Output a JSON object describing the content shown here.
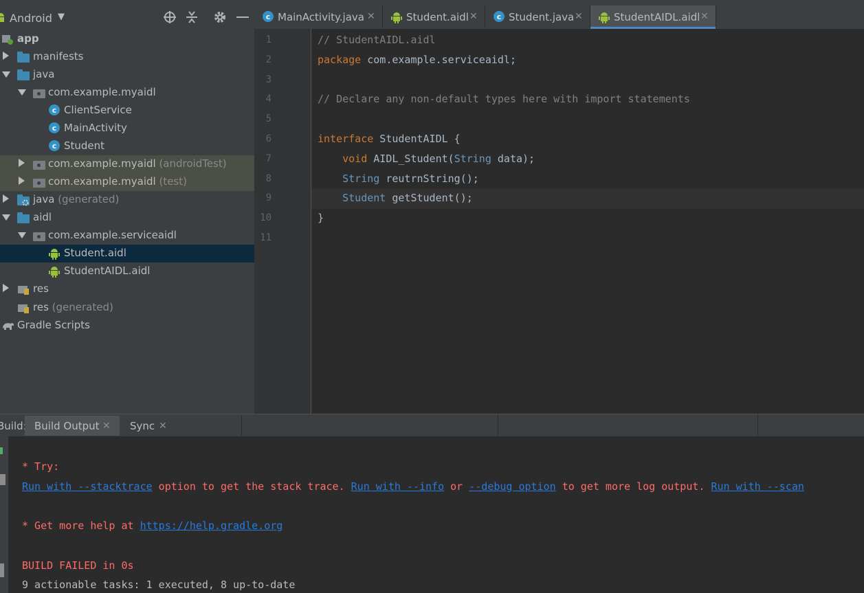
{
  "project_panel": {
    "view_mode": "Android",
    "tree": [
      {
        "label": "app",
        "sublabel": "",
        "icon": "app-module-icon"
      },
      {
        "label": "manifests",
        "sublabel": "",
        "icon": "folder-icon"
      },
      {
        "label": "java",
        "sublabel": "",
        "icon": "folder-icon"
      },
      {
        "label": "com.example.myaidl",
        "sublabel": "",
        "icon": "package-icon"
      },
      {
        "label": "ClientService",
        "sublabel": "",
        "icon": "class-icon"
      },
      {
        "label": "MainActivity",
        "sublabel": "",
        "icon": "class-icon"
      },
      {
        "label": "Student",
        "sublabel": "",
        "icon": "class-icon"
      },
      {
        "label": "com.example.myaidl",
        "sublabel": " (androidTest)",
        "icon": "package-icon"
      },
      {
        "label": "com.example.myaidl",
        "sublabel": " (test)",
        "icon": "package-icon"
      },
      {
        "label": "java",
        "sublabel": " (generated)",
        "icon": "generated-folder-icon"
      },
      {
        "label": "aidl",
        "sublabel": "",
        "icon": "folder-icon"
      },
      {
        "label": "com.example.serviceaidl",
        "sublabel": "",
        "icon": "package-icon"
      },
      {
        "label": "Student.aidl",
        "sublabel": "",
        "icon": "android-icon"
      },
      {
        "label": "StudentAIDL.aidl",
        "sublabel": "",
        "icon": "android-icon"
      },
      {
        "label": "res",
        "sublabel": "",
        "icon": "res-folder-icon"
      },
      {
        "label": "res",
        "sublabel": " (generated)",
        "icon": "res-folder-icon"
      },
      {
        "label": "Gradle Scripts",
        "sublabel": "",
        "icon": "gradle-icon"
      }
    ]
  },
  "editor": {
    "tabs": [
      {
        "label": "MainActivity.java",
        "icon": "class-icon"
      },
      {
        "label": "Student.aidl",
        "icon": "android-icon"
      },
      {
        "label": "Student.java",
        "icon": "class-icon"
      },
      {
        "label": "StudentAIDL.aidl",
        "icon": "android-icon"
      }
    ],
    "active_tab": "StudentAIDL.aidl",
    "current_line": 9,
    "lines": [
      {
        "n": "1",
        "parts": [
          {
            "t": "// StudentAIDL.aidl",
            "c": "cm"
          }
        ]
      },
      {
        "n": "2",
        "parts": [
          {
            "t": "package",
            "c": "kw"
          },
          {
            "t": " com.example.serviceaidl;",
            "c": "ident"
          }
        ]
      },
      {
        "n": "3",
        "parts": []
      },
      {
        "n": "4",
        "parts": [
          {
            "t": "// Declare any non-default types here with import statements",
            "c": "cm"
          }
        ]
      },
      {
        "n": "5",
        "parts": []
      },
      {
        "n": "6",
        "parts": [
          {
            "t": "interface",
            "c": "kw"
          },
          {
            "t": " StudentAIDL {",
            "c": "ident"
          }
        ]
      },
      {
        "n": "7",
        "parts": [
          {
            "t": "    ",
            "c": "ident"
          },
          {
            "t": "void",
            "c": "kw"
          },
          {
            "t": " AIDL_Student(",
            "c": "ident"
          },
          {
            "t": "String",
            "c": "ty"
          },
          {
            "t": " data);",
            "c": "ident"
          }
        ]
      },
      {
        "n": "8",
        "parts": [
          {
            "t": "    ",
            "c": "ident"
          },
          {
            "t": "String",
            "c": "ty"
          },
          {
            "t": " reutrnString();",
            "c": "ident"
          }
        ]
      },
      {
        "n": "9",
        "parts": [
          {
            "t": "    ",
            "c": "ident"
          },
          {
            "t": "Student",
            "c": "ty"
          },
          {
            "t": " getStudent();",
            "c": "ident"
          }
        ]
      },
      {
        "n": "10",
        "parts": [
          {
            "t": "}",
            "c": "ident"
          }
        ]
      },
      {
        "n": "11",
        "parts": []
      }
    ]
  },
  "build_panel": {
    "label": "Build:",
    "tabs": [
      "Build Output",
      "Sync"
    ],
    "console": [
      {
        "parts": [
          {
            "t": "* Try:",
            "c": "err"
          }
        ]
      },
      {
        "parts": [
          {
            "t": "Run with --stacktrace",
            "c": "lnk"
          },
          {
            "t": " option to get the stack trace. ",
            "c": "err"
          },
          {
            "t": "Run with --info",
            "c": "lnk"
          },
          {
            "t": " or ",
            "c": "err"
          },
          {
            "t": "--debug option",
            "c": "lnk"
          },
          {
            "t": " to get more log output. ",
            "c": "err"
          },
          {
            "t": "Run with --scan",
            "c": "lnk"
          }
        ]
      },
      {
        "parts": []
      },
      {
        "parts": [
          {
            "t": "* Get more help at ",
            "c": "err"
          },
          {
            "t": "https://help.gradle.org",
            "c": "lnk"
          }
        ]
      },
      {
        "parts": []
      },
      {
        "parts": [
          {
            "t": "BUILD FAILED in 0s",
            "c": "err"
          }
        ]
      },
      {
        "parts": [
          {
            "t": "9 actionable tasks: 1 executed, 8 up-to-date",
            "c": "normal"
          }
        ]
      }
    ]
  },
  "colors": {
    "panel_bg": "#3c3f41",
    "editor_bg": "#2b2b2b",
    "selection": "#0d293e",
    "keyword": "#cc7832",
    "comment": "#808080",
    "type": "#6897bb",
    "error": "#ff6b68",
    "link": "#287bde",
    "active_tab_underline": "#4a88c7"
  }
}
